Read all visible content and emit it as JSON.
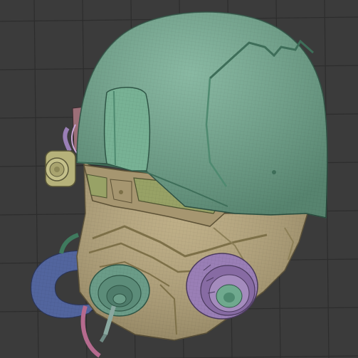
{
  "viewport": {
    "background_color": "#3b3b3b",
    "grid_color": "#2d2d2d",
    "grid_visible": true,
    "wireframe_visible": true
  },
  "model": {
    "parts": [
      {
        "name": "helmet-shell",
        "color": "#6fa98e"
      },
      {
        "name": "visor-brim",
        "color": "#78b295"
      },
      {
        "name": "face-mask",
        "color": "#b6a477"
      },
      {
        "name": "eye-lens",
        "color": "#98a266"
      },
      {
        "name": "left-filter",
        "color": "#9a7fb6"
      },
      {
        "name": "front-filter",
        "color": "#6b9c88"
      },
      {
        "name": "breathing-hose",
        "color": "#52659e"
      },
      {
        "name": "side-light",
        "color": "#b6b27a"
      },
      {
        "name": "hose-cable",
        "color": "#b56a8e"
      },
      {
        "name": "side-strap",
        "color": "#9c6f78"
      }
    ]
  }
}
